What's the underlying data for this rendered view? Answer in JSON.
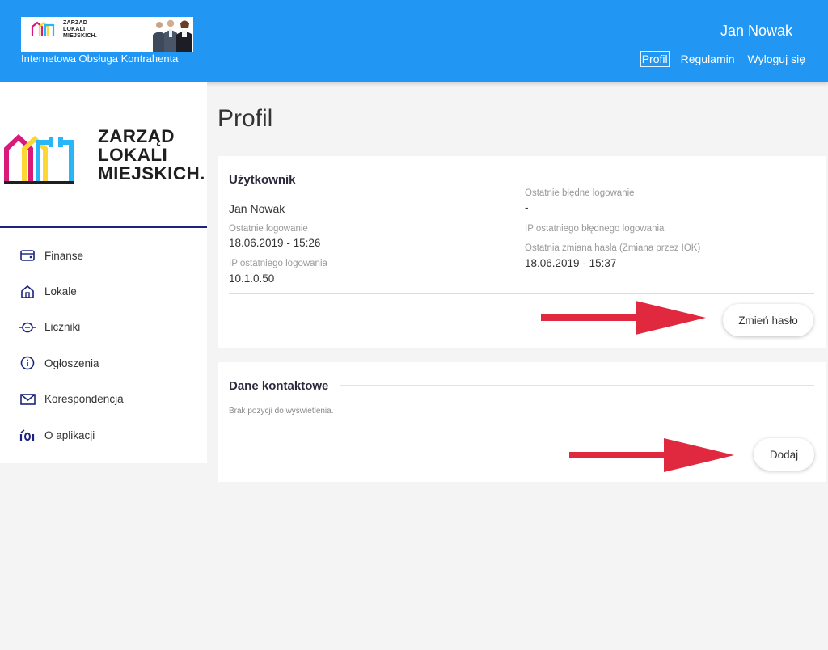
{
  "header": {
    "banner_logo_text": "ZARZĄD\nLOKALI\nMIEJSKICH.",
    "subtitle": "Internetowa Obsługa Kontrahenta",
    "user_name": "Jan Nowak",
    "nav": [
      {
        "label": "Profil",
        "active": true
      },
      {
        "label": "Regulamin",
        "active": false
      },
      {
        "label": "Wyloguj się",
        "active": false
      }
    ]
  },
  "sidebar": {
    "logo_lines": [
      "ZARZĄD",
      "LOKALI",
      "MIEJSKICH."
    ],
    "items": [
      {
        "label": "Finanse",
        "icon": "wallet-icon"
      },
      {
        "label": "Lokale",
        "icon": "home-icon"
      },
      {
        "label": "Liczniki",
        "icon": "meter-icon"
      },
      {
        "label": "Ogłoszenia",
        "icon": "info-icon"
      },
      {
        "label": "Korespondencja",
        "icon": "envelope-icon"
      },
      {
        "label": "O aplikacji",
        "icon": "about-icon"
      }
    ]
  },
  "page": {
    "title": "Profil"
  },
  "user_card": {
    "heading": "Użytkownik",
    "name": "Jan Nowak",
    "last_login_label": "Ostatnie logowanie",
    "last_login_value": "18.06.2019 - 15:26",
    "last_login_ip_label": "IP ostatniego logowania",
    "last_login_ip_value": "10.1.0.50",
    "last_failed_label": "Ostatnie błędne logowanie",
    "last_failed_value": "-",
    "last_failed_ip_label": "IP ostatniego błędnego logowania",
    "password_change_label": "Ostatnia zmiana hasła (Zmiana przez IOK)",
    "password_change_value": "18.06.2019 - 15:37",
    "change_password_button": "Zmień hasło"
  },
  "contact_card": {
    "heading": "Dane kontaktowe",
    "empty_text": "Brak pozycji do wyświetlenia.",
    "add_button": "Dodaj"
  },
  "colors": {
    "header_bg": "#2196f3",
    "sidebar_divider": "#1a237e",
    "icon_color": "#1a237e",
    "arrow_color": "#e0283f"
  }
}
